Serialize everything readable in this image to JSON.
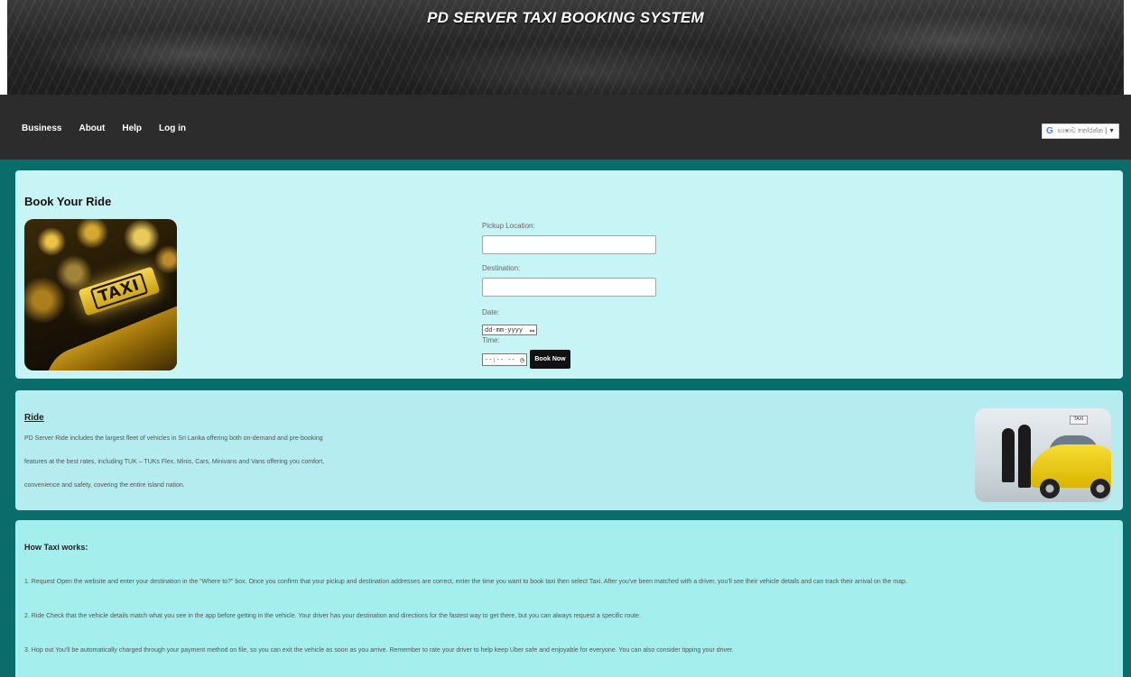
{
  "header": {
    "title": "PD SERVER TAXI BOOKING SYSTEM"
  },
  "nav": {
    "items": [
      {
        "label": "Business"
      },
      {
        "label": "About"
      },
      {
        "label": "Help"
      },
      {
        "label": "Log in"
      }
    ]
  },
  "translate": {
    "label": "භාෂාව තෝරන්න",
    "separator": "|",
    "arrow": "▼",
    "icon": "google-g-icon"
  },
  "booking": {
    "title": "Book Your Ride",
    "pickup_label": "Pickup Location:",
    "pickup_value": "",
    "destination_label": "Destination:",
    "destination_value": "",
    "date_label": "Date:",
    "date_placeholder": "dd-mm-yyyy",
    "time_label": "Time:",
    "time_placeholder": "--:-- --",
    "submit_label": "Book Now",
    "image_text": "TAXI"
  },
  "ride": {
    "title": "Ride",
    "lines": [
      "PD Server Ride includes the largest fleet of vehicles in Sri Lanka offering both on-demand and pre-booking",
      "features at the best rates, including TUK – TUKs Flex, Minis, Cars, Minivans and Vans offering you comfort,",
      "convenience and safety, covering the entire island nation."
    ],
    "image_sign_text": "TAXI"
  },
  "how": {
    "title": "How Taxi works:",
    "steps": [
      "1. Request Open the website and enter your destination in the \"Where to?\" box. Once you confirm that your pickup and destination addresses are correct, enter the time you want to book taxi then select Taxi. After you've been matched with a driver, you'll see their vehicle details and can track their arrival on the map.",
      "2. Ride Check that the vehicle details match what you see in the app before getting in the vehicle. Your driver has your destination and directions for the fastest way to get there, but you can always request a specific route.",
      "3. Hop out You'll be automatically charged through your payment method on file, so you can exit the vehicle as soon as you arrive. Remember to rate your driver to help keep Uber safe and enjoyable for everyone. You can also consider tipping your driver."
    ]
  },
  "colors": {
    "header_bg": "#262626",
    "nav_bg": "#2c2c2c",
    "teal_band": "#0a6d6c",
    "book_card": "#c7f5f5",
    "ride_card": "#b5ecef",
    "how_card": "#a4efed",
    "button": "#111111"
  }
}
